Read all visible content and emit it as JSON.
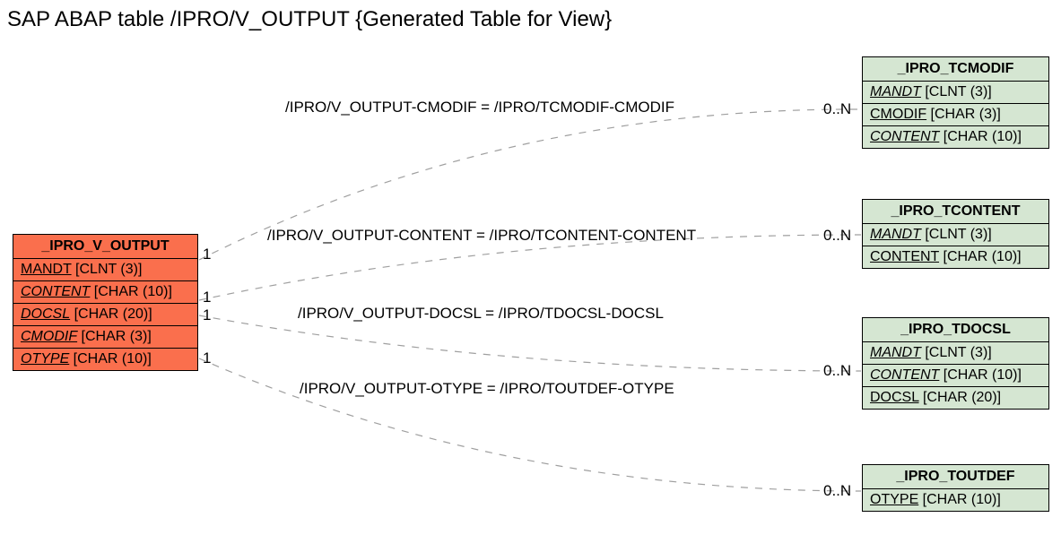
{
  "title": "SAP ABAP table /IPRO/V_OUTPUT {Generated Table for View}",
  "left_entity": {
    "name": "_IPRO_V_OUTPUT",
    "rows": [
      {
        "pre": "MANDT",
        "suf": " [CLNT (3)]",
        "u": true,
        "i": false
      },
      {
        "pre": "CONTENT",
        "suf": " [CHAR (10)]",
        "u": true,
        "i": true
      },
      {
        "pre": "DOCSL",
        "suf": " [CHAR (20)]",
        "u": true,
        "i": true
      },
      {
        "pre": "CMODIF",
        "suf": " [CHAR (3)]",
        "u": true,
        "i": true
      },
      {
        "pre": "OTYPE",
        "suf": " [CHAR (10)]",
        "u": true,
        "i": true
      }
    ]
  },
  "right_entities": [
    {
      "name": "_IPRO_TCMODIF",
      "rows": [
        {
          "pre": "MANDT",
          "suf": " [CLNT (3)]",
          "u": true,
          "i": true
        },
        {
          "pre": "CMODIF",
          "suf": " [CHAR (3)]",
          "u": true,
          "i": false
        },
        {
          "pre": "CONTENT",
          "suf": " [CHAR (10)]",
          "u": true,
          "i": true
        }
      ]
    },
    {
      "name": "_IPRO_TCONTENT",
      "rows": [
        {
          "pre": "MANDT",
          "suf": " [CLNT (3)]",
          "u": true,
          "i": true
        },
        {
          "pre": "CONTENT",
          "suf": " [CHAR (10)]",
          "u": true,
          "i": false
        }
      ]
    },
    {
      "name": "_IPRO_TDOCSL",
      "rows": [
        {
          "pre": "MANDT",
          "suf": " [CLNT (3)]",
          "u": true,
          "i": true
        },
        {
          "pre": "CONTENT",
          "suf": " [CHAR (10)]",
          "u": true,
          "i": true
        },
        {
          "pre": "DOCSL",
          "suf": " [CHAR (20)]",
          "u": true,
          "i": false
        }
      ]
    },
    {
      "name": "_IPRO_TOUTDEF",
      "rows": [
        {
          "pre": "OTYPE",
          "suf": " [CHAR (10)]",
          "u": true,
          "i": false
        }
      ]
    }
  ],
  "edges": [
    {
      "label": "/IPRO/V_OUTPUT-CMODIF = /IPRO/TCMODIF-CMODIF",
      "left_card": "1",
      "right_card": "0..N"
    },
    {
      "label": "/IPRO/V_OUTPUT-CONTENT = /IPRO/TCONTENT-CONTENT",
      "left_card": "1",
      "right_card": "0..N"
    },
    {
      "label": "/IPRO/V_OUTPUT-DOCSL = /IPRO/TDOCSL-DOCSL",
      "left_card": "1",
      "right_card": "0..N"
    },
    {
      "label": "/IPRO/V_OUTPUT-OTYPE = /IPRO/TOUTDEF-OTYPE",
      "left_card": "1",
      "right_card": "0..N"
    }
  ]
}
